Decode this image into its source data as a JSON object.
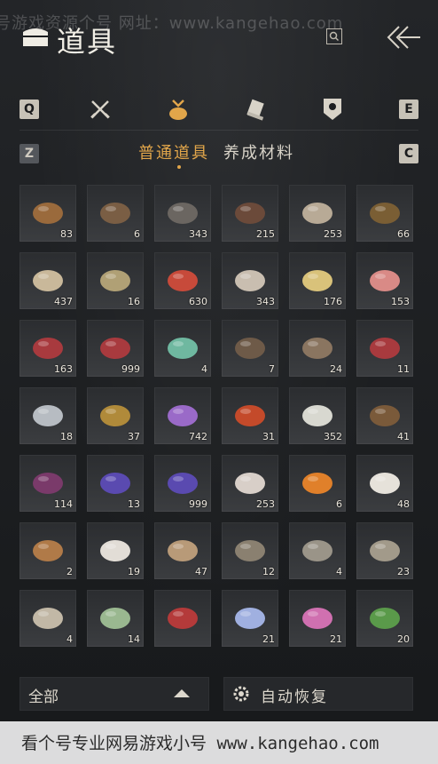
{
  "watermark_top": "号游戏资源个号  网址：www.kangehao.com",
  "header": {
    "title": "道具"
  },
  "tabs": {
    "left_key": "Q",
    "right_key": "E",
    "categories": [
      "weapons",
      "supplies",
      "scroll",
      "badge"
    ],
    "active": 1
  },
  "subtabs": {
    "left_key": "Z",
    "right_key": "C",
    "items": [
      "普通道具",
      "养成材料"
    ],
    "active": 0
  },
  "items": [
    {
      "icon": "sponge-icon",
      "count": "83",
      "color": "#9a6a3c"
    },
    {
      "icon": "logs-icon",
      "count": "6",
      "color": "#7a5e44"
    },
    {
      "icon": "ore-icon",
      "count": "343",
      "color": "#6b6661"
    },
    {
      "icon": "feather-icon",
      "count": "215",
      "color": "#6b4a3a"
    },
    {
      "icon": "mushroom-icon",
      "count": "253",
      "color": "#b8aa96"
    },
    {
      "icon": "insect-icon",
      "count": "66",
      "color": "#7a5e34"
    },
    {
      "icon": "grain-sack-icon",
      "count": "437",
      "color": "#c9b89a"
    },
    {
      "icon": "fish-icon",
      "count": "16",
      "color": "#b0a075"
    },
    {
      "icon": "berries-icon",
      "count": "630",
      "color": "#c74a3a"
    },
    {
      "icon": "mushrooms-icon",
      "count": "343",
      "color": "#c9beb0"
    },
    {
      "icon": "eggs-icon",
      "count": "176",
      "color": "#d9c27a"
    },
    {
      "icon": "meat-chunks-icon",
      "count": "153",
      "color": "#d98a86"
    },
    {
      "icon": "steak-icon",
      "count": "163",
      "color": "#a83a3e"
    },
    {
      "icon": "steak-icon",
      "count": "999",
      "color": "#a83a3e"
    },
    {
      "icon": "jade-icon",
      "count": "4",
      "color": "#6fb8a0"
    },
    {
      "icon": "feathers-icon",
      "count": "7",
      "color": "#6e5a48"
    },
    {
      "icon": "hide-icon",
      "count": "24",
      "color": "#8a7560"
    },
    {
      "icon": "steak-icon",
      "count": "11",
      "color": "#a83a3e"
    },
    {
      "icon": "salmon-icon",
      "count": "18",
      "color": "#b7bcc2"
    },
    {
      "icon": "fungus-icon",
      "count": "37",
      "color": "#b08a3a"
    },
    {
      "icon": "amethyst-icon",
      "count": "742",
      "color": "#9a6ac8"
    },
    {
      "icon": "agate-icon",
      "count": "31",
      "color": "#c44a2a"
    },
    {
      "icon": "herb-flower-icon",
      "count": "352",
      "color": "#d8d8d0"
    },
    {
      "icon": "mortar-icon",
      "count": "41",
      "color": "#7a5a3a"
    },
    {
      "icon": "purple-leaf-icon",
      "count": "114",
      "color": "#7a3a6a"
    },
    {
      "icon": "lavender-icon",
      "count": "13",
      "color": "#5a4ab0"
    },
    {
      "icon": "lavender-icon",
      "count": "999",
      "color": "#5a4ab0"
    },
    {
      "icon": "white-flower-icon",
      "count": "253",
      "color": "#d8cfc8"
    },
    {
      "icon": "orange-flower-icon",
      "count": "6",
      "color": "#e0802a"
    },
    {
      "icon": "white-feather-icon",
      "count": "48",
      "color": "#e6e2da"
    },
    {
      "icon": "fur-icon",
      "count": "2",
      "color": "#b07a48"
    },
    {
      "icon": "white-fur-icon",
      "count": "19",
      "color": "#e2ddd6"
    },
    {
      "icon": "pufferfish-icon",
      "count": "47",
      "color": "#b89a78"
    },
    {
      "icon": "grouper-icon",
      "count": "12",
      "color": "#8a8070"
    },
    {
      "icon": "grouper-icon",
      "count": "4",
      "color": "#9a9488"
    },
    {
      "icon": "grouper-icon",
      "count": "23",
      "color": "#a29a8a"
    },
    {
      "icon": "bone-icon",
      "count": "4",
      "color": "#c2b8a6"
    },
    {
      "icon": "melon-icon",
      "count": "14",
      "color": "#9ab890"
    },
    {
      "icon": "red-herb-icon",
      "count": "",
      "color": "#b43a3a"
    },
    {
      "icon": "blue-flower-icon",
      "count": "21",
      "color": "#a0b0e0"
    },
    {
      "icon": "pink-flower-icon",
      "count": "21",
      "color": "#d070b0"
    },
    {
      "icon": "green-herb-icon",
      "count": "20",
      "color": "#5a9a4a"
    }
  ],
  "bottom": {
    "filter_label": "全部",
    "auto_label": "自动恢复"
  },
  "watermark_bottom": "看个号专业网易游戏小号  www.kangehao.com"
}
